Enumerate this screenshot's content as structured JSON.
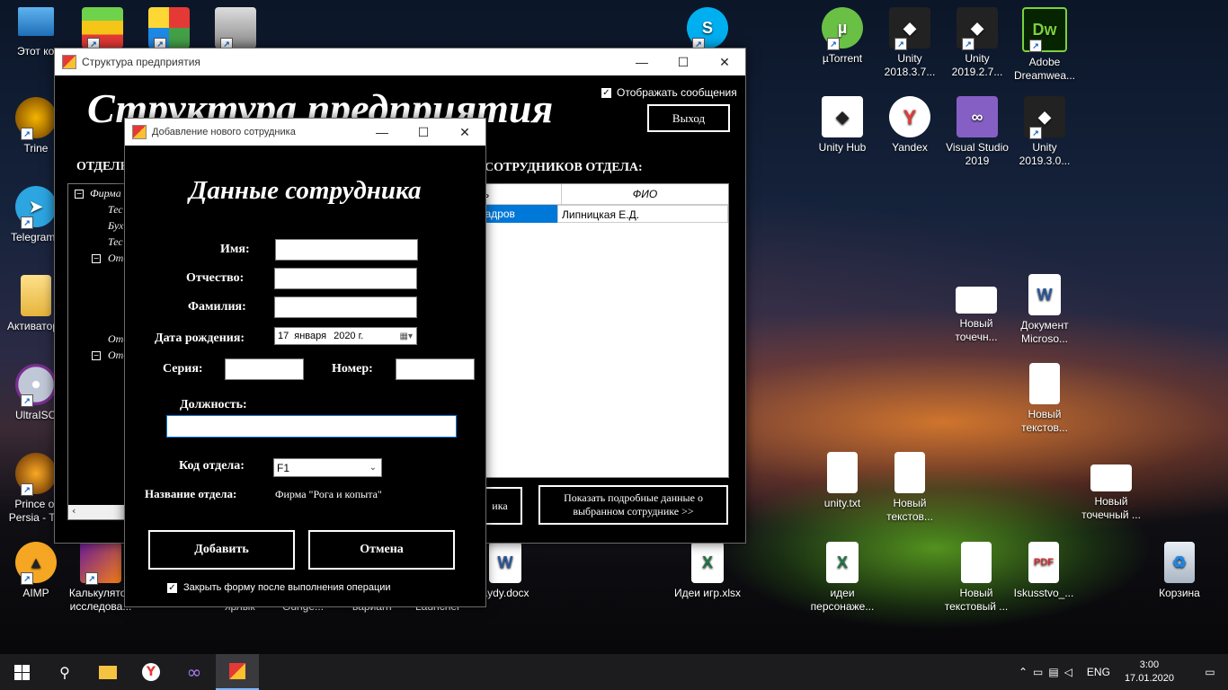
{
  "desktop_left": [
    {
      "label": "Этот компьютер",
      "icon": "computer-icon"
    },
    {
      "label": "Trine",
      "icon": "trine-icon"
    },
    {
      "label": "Telegram",
      "icon": "telegram-icon"
    },
    {
      "label": "Активатор",
      "icon": "folder-icon"
    },
    {
      "label": "UltraISO",
      "icon": "disc-icon"
    },
    {
      "label": "Prince of Persia - T...",
      "icon": "prince-icon"
    },
    {
      "label": "AIMP",
      "icon": "aimp-icon"
    }
  ],
  "desktop_bottom": [
    {
      "label": "Калькулятор исследова...",
      "icon": "game-icon"
    },
    {
      "label": "ярлык",
      "icon": "shortcut-icon"
    },
    {
      "label": "Gunge...",
      "icon": "shortcut-icon"
    },
    {
      "label": "вариант",
      "icon": "shortcut-icon"
    },
    {
      "label": "Launcher",
      "icon": "shortcut-icon"
    },
    {
      "label": "aydy.docx",
      "icon": "word-doc-icon"
    },
    {
      "label": "Идеи игр.xlsx",
      "icon": "excel-icon"
    },
    {
      "label": "идеи персонаже...",
      "icon": "excel-icon"
    },
    {
      "label": "Новый текстовый ...",
      "icon": "text-file-icon"
    },
    {
      "label": "Iskusstvo_...",
      "icon": "pdf-icon"
    },
    {
      "label": "Корзина",
      "icon": "recycle-bin-icon"
    }
  ],
  "desktop_right": [
    {
      "label": "µTorrent",
      "icon": "utorrent-icon"
    },
    {
      "label": "Unity 2018.3.7...",
      "icon": "unity-icon"
    },
    {
      "label": "Unity 2019.2.7...",
      "icon": "unity-icon"
    },
    {
      "label": "Adobe Dreamwea...",
      "icon": "dreamweaver-icon"
    },
    {
      "label": "Unity Hub",
      "icon": "unity-hub-icon"
    },
    {
      "label": "Yandex",
      "icon": "yandex-icon"
    },
    {
      "label": "Visual Studio 2019",
      "icon": "visual-studio-icon"
    },
    {
      "label": "Unity 2019.3.0...",
      "icon": "unity-icon"
    },
    {
      "label": "Новый точечн...",
      "icon": "bitmap-icon"
    },
    {
      "label": "Документ Microso...",
      "icon": "word-doc-icon"
    },
    {
      "label": "Новый текстов...",
      "icon": "text-file-icon"
    },
    {
      "label": "unity.txt",
      "icon": "text-file-icon"
    },
    {
      "label": "Новый текстов...",
      "icon": "text-file-icon"
    },
    {
      "label": "Новый точечный ...",
      "icon": "bitmap-icon"
    }
  ],
  "top_icons": [
    {
      "label": "",
      "icon": "bluestacks-icon"
    },
    {
      "label": "",
      "icon": "rubik-icon"
    },
    {
      "label": "",
      "icon": "speaker-icon"
    },
    {
      "label": "",
      "icon": "skype-icon"
    }
  ],
  "main_window": {
    "title": "Структура предприятия",
    "heading": "Структура предприятия",
    "show_messages_label": "Отображать сообщения",
    "show_messages_checked": true,
    "exit_label": "Выход",
    "departments_label": "ОТДЕЛЫ",
    "employees_label": "СОТРУДНИКОВ ОТДЕЛА:",
    "tree": [
      "Фирма",
      "Тес",
      "Бух",
      "Тес",
      "Отд",
      "Отд",
      "Отд"
    ],
    "table": {
      "headers": [
        "ь",
        "ФИО"
      ],
      "rows": [
        [
          "кадров",
          "Липницкая Е.Д."
        ]
      ]
    },
    "partial_button_label": "ика",
    "details_button_label": "Показать подробные данные о выбранном сотруднике >>"
  },
  "dialog": {
    "title": "Добавление нового сотрудника",
    "heading": "Данные сотрудника",
    "first_name_label": "Имя:",
    "first_name_value": "",
    "patronymic_label": "Отчество:",
    "patronymic_value": "",
    "last_name_label": "Фамилия:",
    "last_name_value": "",
    "birth_label": "Дата рождения:",
    "birth_day": "17",
    "birth_month": "января",
    "birth_year": "2020 г.",
    "series_label": "Серия:",
    "series_value": "",
    "number_label": "Номер:",
    "number_value": "",
    "position_label": "Должность:",
    "position_value": "",
    "dept_code_label": "Код отдела:",
    "dept_code_value": "F1",
    "dept_name_label": "Название отдела:",
    "dept_name_value": "Фирма \"Рога и копыта\"",
    "add_label": "Добавить",
    "cancel_label": "Отмена",
    "close_after_label": "Закрыть форму после выполнения операции",
    "close_after_checked": true
  },
  "taskbar": {
    "lang": "ENG",
    "time": "3:00",
    "date": "17.01.2020"
  },
  "colors": {
    "window_bg": "#000000",
    "selection": "#0078d7",
    "taskbar": "#1c1c1f"
  }
}
